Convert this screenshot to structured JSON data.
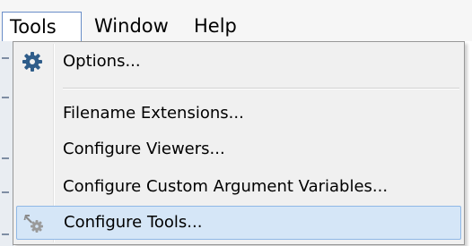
{
  "menubar": {
    "items": [
      {
        "label": "Tools",
        "active": true
      },
      {
        "label": "Window",
        "active": false
      },
      {
        "label": "Help",
        "active": false
      }
    ]
  },
  "dropdown": {
    "items": [
      {
        "label": "Options...",
        "icon": "gear-icon"
      },
      {
        "label": "Filename Extensions...",
        "icon": ""
      },
      {
        "label": "Configure Viewers...",
        "icon": ""
      },
      {
        "label": "Configure Custom Argument Variables...",
        "icon": ""
      },
      {
        "label": "Configure Tools...",
        "icon": "tools-icon",
        "highlighted": true
      }
    ]
  },
  "colors": {
    "highlight_fill": "#d5e6f7",
    "highlight_border": "#8fb8e6",
    "menu_background": "#f0f0f0",
    "active_menu_border": "#6a8ec8"
  }
}
